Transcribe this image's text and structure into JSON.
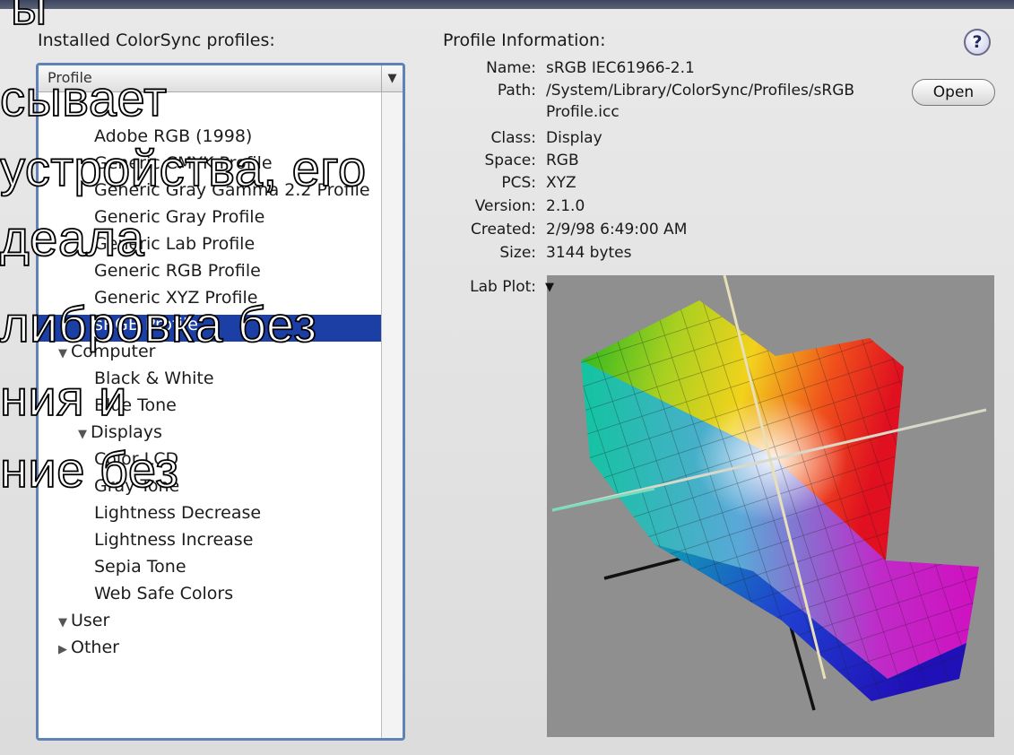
{
  "window": {
    "installed_label": "Installed ColorSync profiles:",
    "info_label": "Profile Information:",
    "help_glyph": "?"
  },
  "profile_list": {
    "header": "Profile",
    "rows": [
      {
        "label": "",
        "indent": 0,
        "tri": ""
      },
      {
        "label": "Adobe RGB (1998)",
        "indent": 2,
        "tri": ""
      },
      {
        "label": "Generic CMYK Profile",
        "indent": 2,
        "tri": ""
      },
      {
        "label": "Generic Gray Gamma 2.2 Profile",
        "indent": 2,
        "tri": ""
      },
      {
        "label": "Generic Gray Profile",
        "indent": 2,
        "tri": ""
      },
      {
        "label": "Generic Lab Profile",
        "indent": 2,
        "tri": ""
      },
      {
        "label": "Generic RGB Profile",
        "indent": 2,
        "tri": ""
      },
      {
        "label": "Generic XYZ Profile",
        "indent": 2,
        "tri": ""
      },
      {
        "label": "sRGB Profile",
        "indent": 2,
        "tri": "",
        "selected": true
      },
      {
        "label": "Computer",
        "indent": 0,
        "tri": "▼"
      },
      {
        "label": "Black & White",
        "indent": 2,
        "tri": ""
      },
      {
        "label": "Blue Tone",
        "indent": 2,
        "tri": ""
      },
      {
        "label": "Displays",
        "indent": 1,
        "tri": "▼"
      },
      {
        "label": "Color LCD",
        "indent": 2,
        "tri": ""
      },
      {
        "label": "Gray Tone",
        "indent": 2,
        "tri": ""
      },
      {
        "label": "Lightness Decrease",
        "indent": 2,
        "tri": ""
      },
      {
        "label": "Lightness Increase",
        "indent": 2,
        "tri": ""
      },
      {
        "label": "Sepia Tone",
        "indent": 2,
        "tri": ""
      },
      {
        "label": "Web Safe Colors",
        "indent": 2,
        "tri": ""
      },
      {
        "label": "User",
        "indent": 0,
        "tri": "▼"
      },
      {
        "label": "Other",
        "indent": 0,
        "tri": "▶"
      }
    ]
  },
  "info": {
    "name_key": "Name:",
    "name": "sRGB IEC61966-2.1",
    "path_key": "Path:",
    "path_line1": "/System/Library/ColorSync/Profiles/sRGB",
    "path_line2": "Profile.icc",
    "open_button": "Open",
    "class_key": "Class:",
    "class": "Display",
    "space_key": "Space:",
    "space": "RGB",
    "pcs_key": "PCS:",
    "pcs": "XYZ",
    "version_key": "Version:",
    "version": "2.1.0",
    "created_key": "Created:",
    "created": "2/9/98 6:49:00 AM",
    "size_key": "Size:",
    "size": "3144 bytes",
    "lab_plot_key": "Lab Plot:",
    "lab_plot_menu_glyph": "▼"
  },
  "overlay_text": [
    "ы",
    "сывает",
    "устройства, его",
    "деала",
    "либровка без",
    "ния и",
    "ние без"
  ],
  "colors": {
    "selection": "#1c3fa6",
    "focus_ring": "#5f82b8",
    "plot_bg": "#8f8f8f"
  }
}
